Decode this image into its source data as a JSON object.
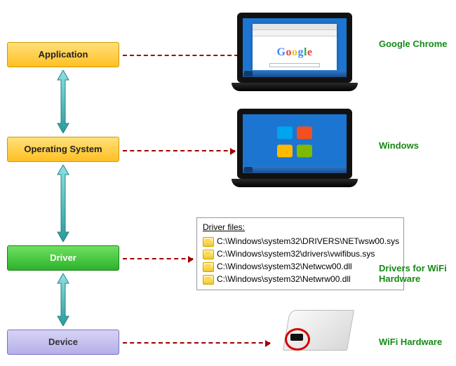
{
  "layers": {
    "application": {
      "label": "Application"
    },
    "os": {
      "label": "Operating System"
    },
    "driver": {
      "label": "Driver"
    },
    "device": {
      "label": "Device"
    }
  },
  "examples": {
    "application_label": "Google Chrome",
    "os_label": "Windows",
    "driver_label": "Drivers for WiFi Hardware",
    "device_label": "WiFi Hardware"
  },
  "browser_logo": {
    "c1": "G",
    "c2": "o",
    "c3": "o",
    "c4": "g",
    "c5": "l",
    "c6": "e"
  },
  "driver_files": {
    "title": "Driver files:",
    "items": [
      "C:\\Windows\\system32\\DRIVERS\\NETwsw00.sys",
      "C:\\Windows\\system32\\drivers\\vwifibus.sys",
      "C:\\Windows\\system32\\Netwcw00.dll",
      "C:\\Windows\\system32\\Netwrw00.dll"
    ]
  }
}
